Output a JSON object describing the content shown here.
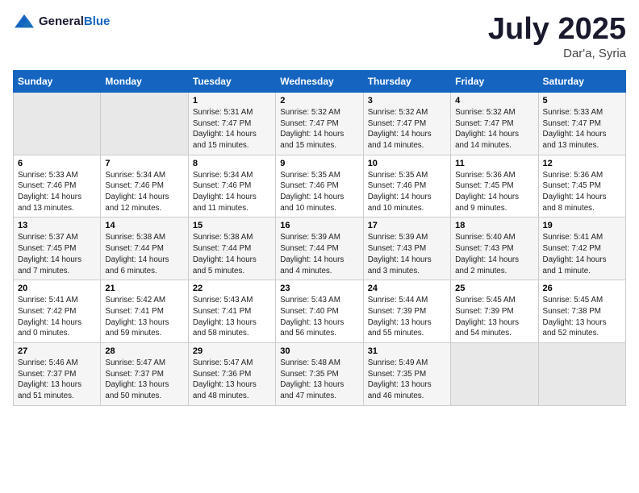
{
  "logo": {
    "text_general": "General",
    "text_blue": "Blue"
  },
  "header": {
    "month": "July 2025",
    "location": "Dar'a, Syria"
  },
  "days_of_week": [
    "Sunday",
    "Monday",
    "Tuesday",
    "Wednesday",
    "Thursday",
    "Friday",
    "Saturday"
  ],
  "weeks": [
    [
      {
        "day": "",
        "empty": true
      },
      {
        "day": "",
        "empty": true
      },
      {
        "day": "1",
        "sunrise": "5:31 AM",
        "sunset": "7:47 PM",
        "daylight": "14 hours and 15 minutes."
      },
      {
        "day": "2",
        "sunrise": "5:32 AM",
        "sunset": "7:47 PM",
        "daylight": "14 hours and 15 minutes."
      },
      {
        "day": "3",
        "sunrise": "5:32 AM",
        "sunset": "7:47 PM",
        "daylight": "14 hours and 14 minutes."
      },
      {
        "day": "4",
        "sunrise": "5:32 AM",
        "sunset": "7:47 PM",
        "daylight": "14 hours and 14 minutes."
      },
      {
        "day": "5",
        "sunrise": "5:33 AM",
        "sunset": "7:47 PM",
        "daylight": "14 hours and 13 minutes."
      }
    ],
    [
      {
        "day": "6",
        "sunrise": "5:33 AM",
        "sunset": "7:46 PM",
        "daylight": "14 hours and 13 minutes."
      },
      {
        "day": "7",
        "sunrise": "5:34 AM",
        "sunset": "7:46 PM",
        "daylight": "14 hours and 12 minutes."
      },
      {
        "day": "8",
        "sunrise": "5:34 AM",
        "sunset": "7:46 PM",
        "daylight": "14 hours and 11 minutes."
      },
      {
        "day": "9",
        "sunrise": "5:35 AM",
        "sunset": "7:46 PM",
        "daylight": "14 hours and 10 minutes."
      },
      {
        "day": "10",
        "sunrise": "5:35 AM",
        "sunset": "7:46 PM",
        "daylight": "14 hours and 10 minutes."
      },
      {
        "day": "11",
        "sunrise": "5:36 AM",
        "sunset": "7:45 PM",
        "daylight": "14 hours and 9 minutes."
      },
      {
        "day": "12",
        "sunrise": "5:36 AM",
        "sunset": "7:45 PM",
        "daylight": "14 hours and 8 minutes."
      }
    ],
    [
      {
        "day": "13",
        "sunrise": "5:37 AM",
        "sunset": "7:45 PM",
        "daylight": "14 hours and 7 minutes."
      },
      {
        "day": "14",
        "sunrise": "5:38 AM",
        "sunset": "7:44 PM",
        "daylight": "14 hours and 6 minutes."
      },
      {
        "day": "15",
        "sunrise": "5:38 AM",
        "sunset": "7:44 PM",
        "daylight": "14 hours and 5 minutes."
      },
      {
        "day": "16",
        "sunrise": "5:39 AM",
        "sunset": "7:44 PM",
        "daylight": "14 hours and 4 minutes."
      },
      {
        "day": "17",
        "sunrise": "5:39 AM",
        "sunset": "7:43 PM",
        "daylight": "14 hours and 3 minutes."
      },
      {
        "day": "18",
        "sunrise": "5:40 AM",
        "sunset": "7:43 PM",
        "daylight": "14 hours and 2 minutes."
      },
      {
        "day": "19",
        "sunrise": "5:41 AM",
        "sunset": "7:42 PM",
        "daylight": "14 hours and 1 minute."
      }
    ],
    [
      {
        "day": "20",
        "sunrise": "5:41 AM",
        "sunset": "7:42 PM",
        "daylight": "14 hours and 0 minutes."
      },
      {
        "day": "21",
        "sunrise": "5:42 AM",
        "sunset": "7:41 PM",
        "daylight": "13 hours and 59 minutes."
      },
      {
        "day": "22",
        "sunrise": "5:43 AM",
        "sunset": "7:41 PM",
        "daylight": "13 hours and 58 minutes."
      },
      {
        "day": "23",
        "sunrise": "5:43 AM",
        "sunset": "7:40 PM",
        "daylight": "13 hours and 56 minutes."
      },
      {
        "day": "24",
        "sunrise": "5:44 AM",
        "sunset": "7:39 PM",
        "daylight": "13 hours and 55 minutes."
      },
      {
        "day": "25",
        "sunrise": "5:45 AM",
        "sunset": "7:39 PM",
        "daylight": "13 hours and 54 minutes."
      },
      {
        "day": "26",
        "sunrise": "5:45 AM",
        "sunset": "7:38 PM",
        "daylight": "13 hours and 52 minutes."
      }
    ],
    [
      {
        "day": "27",
        "sunrise": "5:46 AM",
        "sunset": "7:37 PM",
        "daylight": "13 hours and 51 minutes."
      },
      {
        "day": "28",
        "sunrise": "5:47 AM",
        "sunset": "7:37 PM",
        "daylight": "13 hours and 50 minutes."
      },
      {
        "day": "29",
        "sunrise": "5:47 AM",
        "sunset": "7:36 PM",
        "daylight": "13 hours and 48 minutes."
      },
      {
        "day": "30",
        "sunrise": "5:48 AM",
        "sunset": "7:35 PM",
        "daylight": "13 hours and 47 minutes."
      },
      {
        "day": "31",
        "sunrise": "5:49 AM",
        "sunset": "7:35 PM",
        "daylight": "13 hours and 46 minutes."
      },
      {
        "day": "",
        "empty": true
      },
      {
        "day": "",
        "empty": true
      }
    ]
  ],
  "labels": {
    "sunrise": "Sunrise:",
    "sunset": "Sunset:",
    "daylight": "Daylight:"
  }
}
